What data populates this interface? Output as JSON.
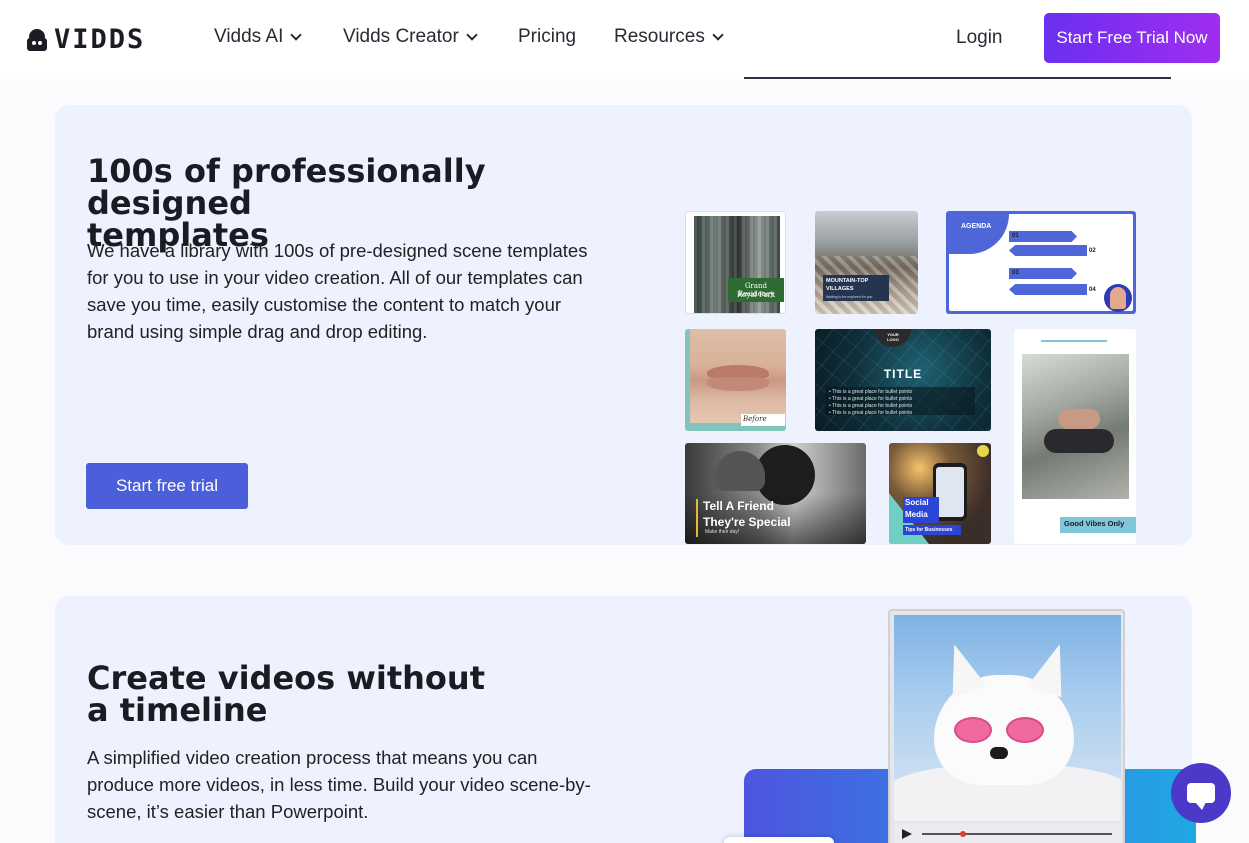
{
  "nav": {
    "logo": "VIDDS",
    "items": [
      {
        "label": "Vidds AI",
        "dropdown": true
      },
      {
        "label": "Vidds Creator",
        "dropdown": true
      },
      {
        "label": "Pricing",
        "dropdown": false
      },
      {
        "label": "Resources",
        "dropdown": true
      }
    ],
    "login": "Login",
    "cta": "Start Free Trial Now"
  },
  "section1": {
    "heading_line1": "100s of professionally designed",
    "heading_line2": "templates",
    "paragraph": "We have a library with 100s of pre-designed scene templates for you to use in your video creation. All of our templates can save you time, easily customise the content to match your brand using simple drag and drop editing.",
    "button": "Start free trial",
    "tiles": {
      "residency_l1": "Grand Residency",
      "residency_l2": "Royal Park",
      "mountain_l1": "MOUNTAIN-TOP",
      "mountain_l2": "VILLAGES",
      "mountain_sub": "Waiting to be explored for you",
      "agenda": "AGENDA",
      "agenda_nums": [
        "01",
        "02",
        "03",
        "04"
      ],
      "before": "Before",
      "logo_badge_l1": "YOUR",
      "logo_badge_l2": "LOGO",
      "title": "TITLE",
      "bullet": "• This is a great place for bullet points",
      "good_vibes": "Good Vibes Only",
      "friend_l1": "Tell A Friend",
      "friend_l2": "They're Special",
      "friend_sub": "Make their day!",
      "social_l1": "Social",
      "social_l2": "Media",
      "social_sub": "Tips for Businesses"
    }
  },
  "section2": {
    "heading_line1": "Create videos without",
    "heading_line2": "a timeline",
    "paragraph": "A simplified video creation process that means you can produce more videos, in less time. Build your video scene-by-scene, it’s easier than Powerpoint."
  },
  "colors": {
    "cta_gradient_start": "#6b2ff0",
    "cta_gradient_end": "#a02df0",
    "trial_button": "#4a5fd9",
    "card_bg": "#eef2fe",
    "chat_button": "#4b3ac9"
  },
  "icons": {
    "chevron": "chevron-down-icon",
    "chat": "chat-icon",
    "play": "play-icon"
  }
}
